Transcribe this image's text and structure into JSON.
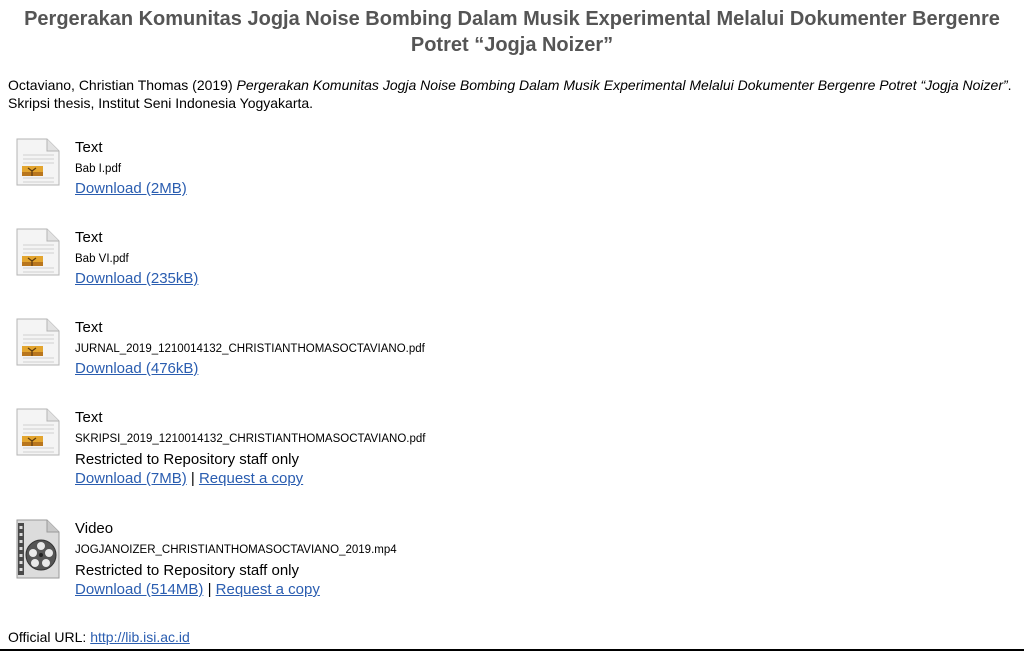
{
  "title": "Pergerakan Komunitas Jogja Noise Bombing Dalam Musik Experimental Melalui Dokumenter Bergenre Potret “Jogja Noizer”",
  "citation": {
    "authors_year": "Octaviano, Christian Thomas (2019) ",
    "work_title": "Pergerakan Komunitas Jogja Noise Bombing Dalam Musik Experimental Melalui Dokumenter Bergenre Potret “Jogja Noizer”",
    "rest": ". Skripsi thesis, Institut Seni Indonesia Yogyakarta."
  },
  "documents": [
    {
      "icon": "text-document-icon",
      "format": "Text",
      "filename": "Bab I.pdf",
      "download_label": "Download (2MB)"
    },
    {
      "icon": "text-document-icon",
      "format": "Text",
      "filename": "Bab VI.pdf",
      "download_label": "Download (235kB)"
    },
    {
      "icon": "text-document-icon",
      "format": "Text",
      "filename": "JURNAL_2019_1210014132_CHRISTIANTHOMASOCTAVIANO.pdf",
      "download_label": "Download (476kB)"
    },
    {
      "icon": "text-document-icon",
      "format": "Text",
      "filename": "SKRIPSI_2019_1210014132_CHRISTIANTHOMASOCTAVIANO.pdf",
      "restricted": "Restricted to Repository staff only",
      "download_label": "Download (7MB)",
      "separator": " | ",
      "request_label": "Request a copy"
    },
    {
      "icon": "video-film-reel-icon",
      "format": "Video",
      "filename": "JOGJANOIZER_CHRISTIANTHOMASOCTAVIANO_2019.mp4",
      "restricted": "Restricted to Repository staff only",
      "download_label": "Download (514MB)",
      "separator": " | ",
      "request_label": "Request a copy"
    }
  ],
  "official_url": {
    "label": "Official URL: ",
    "link": "http://lib.isi.ac.id"
  },
  "colors": {
    "link": "#2a5db0",
    "title": "#555555"
  }
}
